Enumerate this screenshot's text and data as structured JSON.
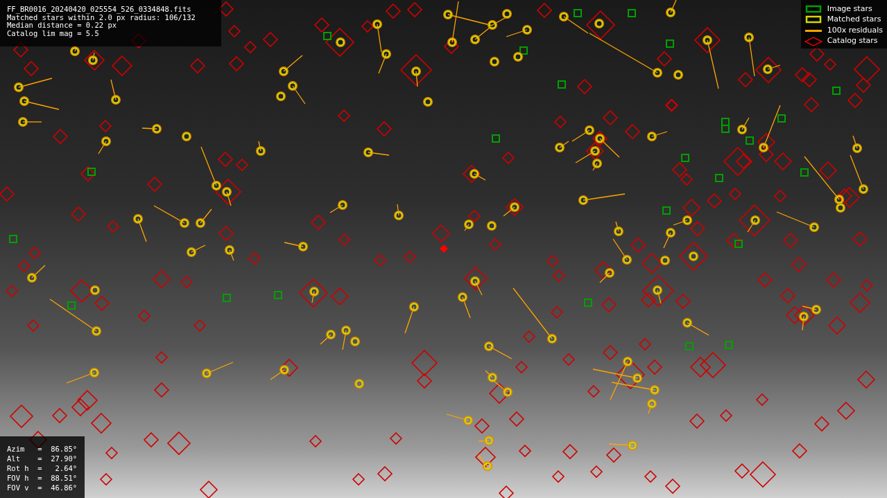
{
  "header": {
    "lines": [
      "FF_BR0016_20240420_025554_526_0334848.fits",
      "Matched stars within 2.0 px radius: 106/132",
      "Median distance = 0.22 px",
      "Catalog lim mag = 5.5"
    ]
  },
  "legend": [
    {
      "kind": "box",
      "color": "#00a000",
      "label": "Image stars"
    },
    {
      "kind": "box",
      "color": "#d8d800",
      "label": "Matched stars"
    },
    {
      "kind": "line",
      "color": "#ffa500",
      "label": "100x residuals"
    },
    {
      "kind": "diamond",
      "color": "#e00000",
      "label": "Catalog stars"
    }
  ],
  "pointing": [
    "Azim   =  86.85°",
    "Alt    =  27.90°",
    "Rot h  =   2.64°",
    "FOV h  =  88.51°",
    "FOV v  =  46.86°"
  ]
}
